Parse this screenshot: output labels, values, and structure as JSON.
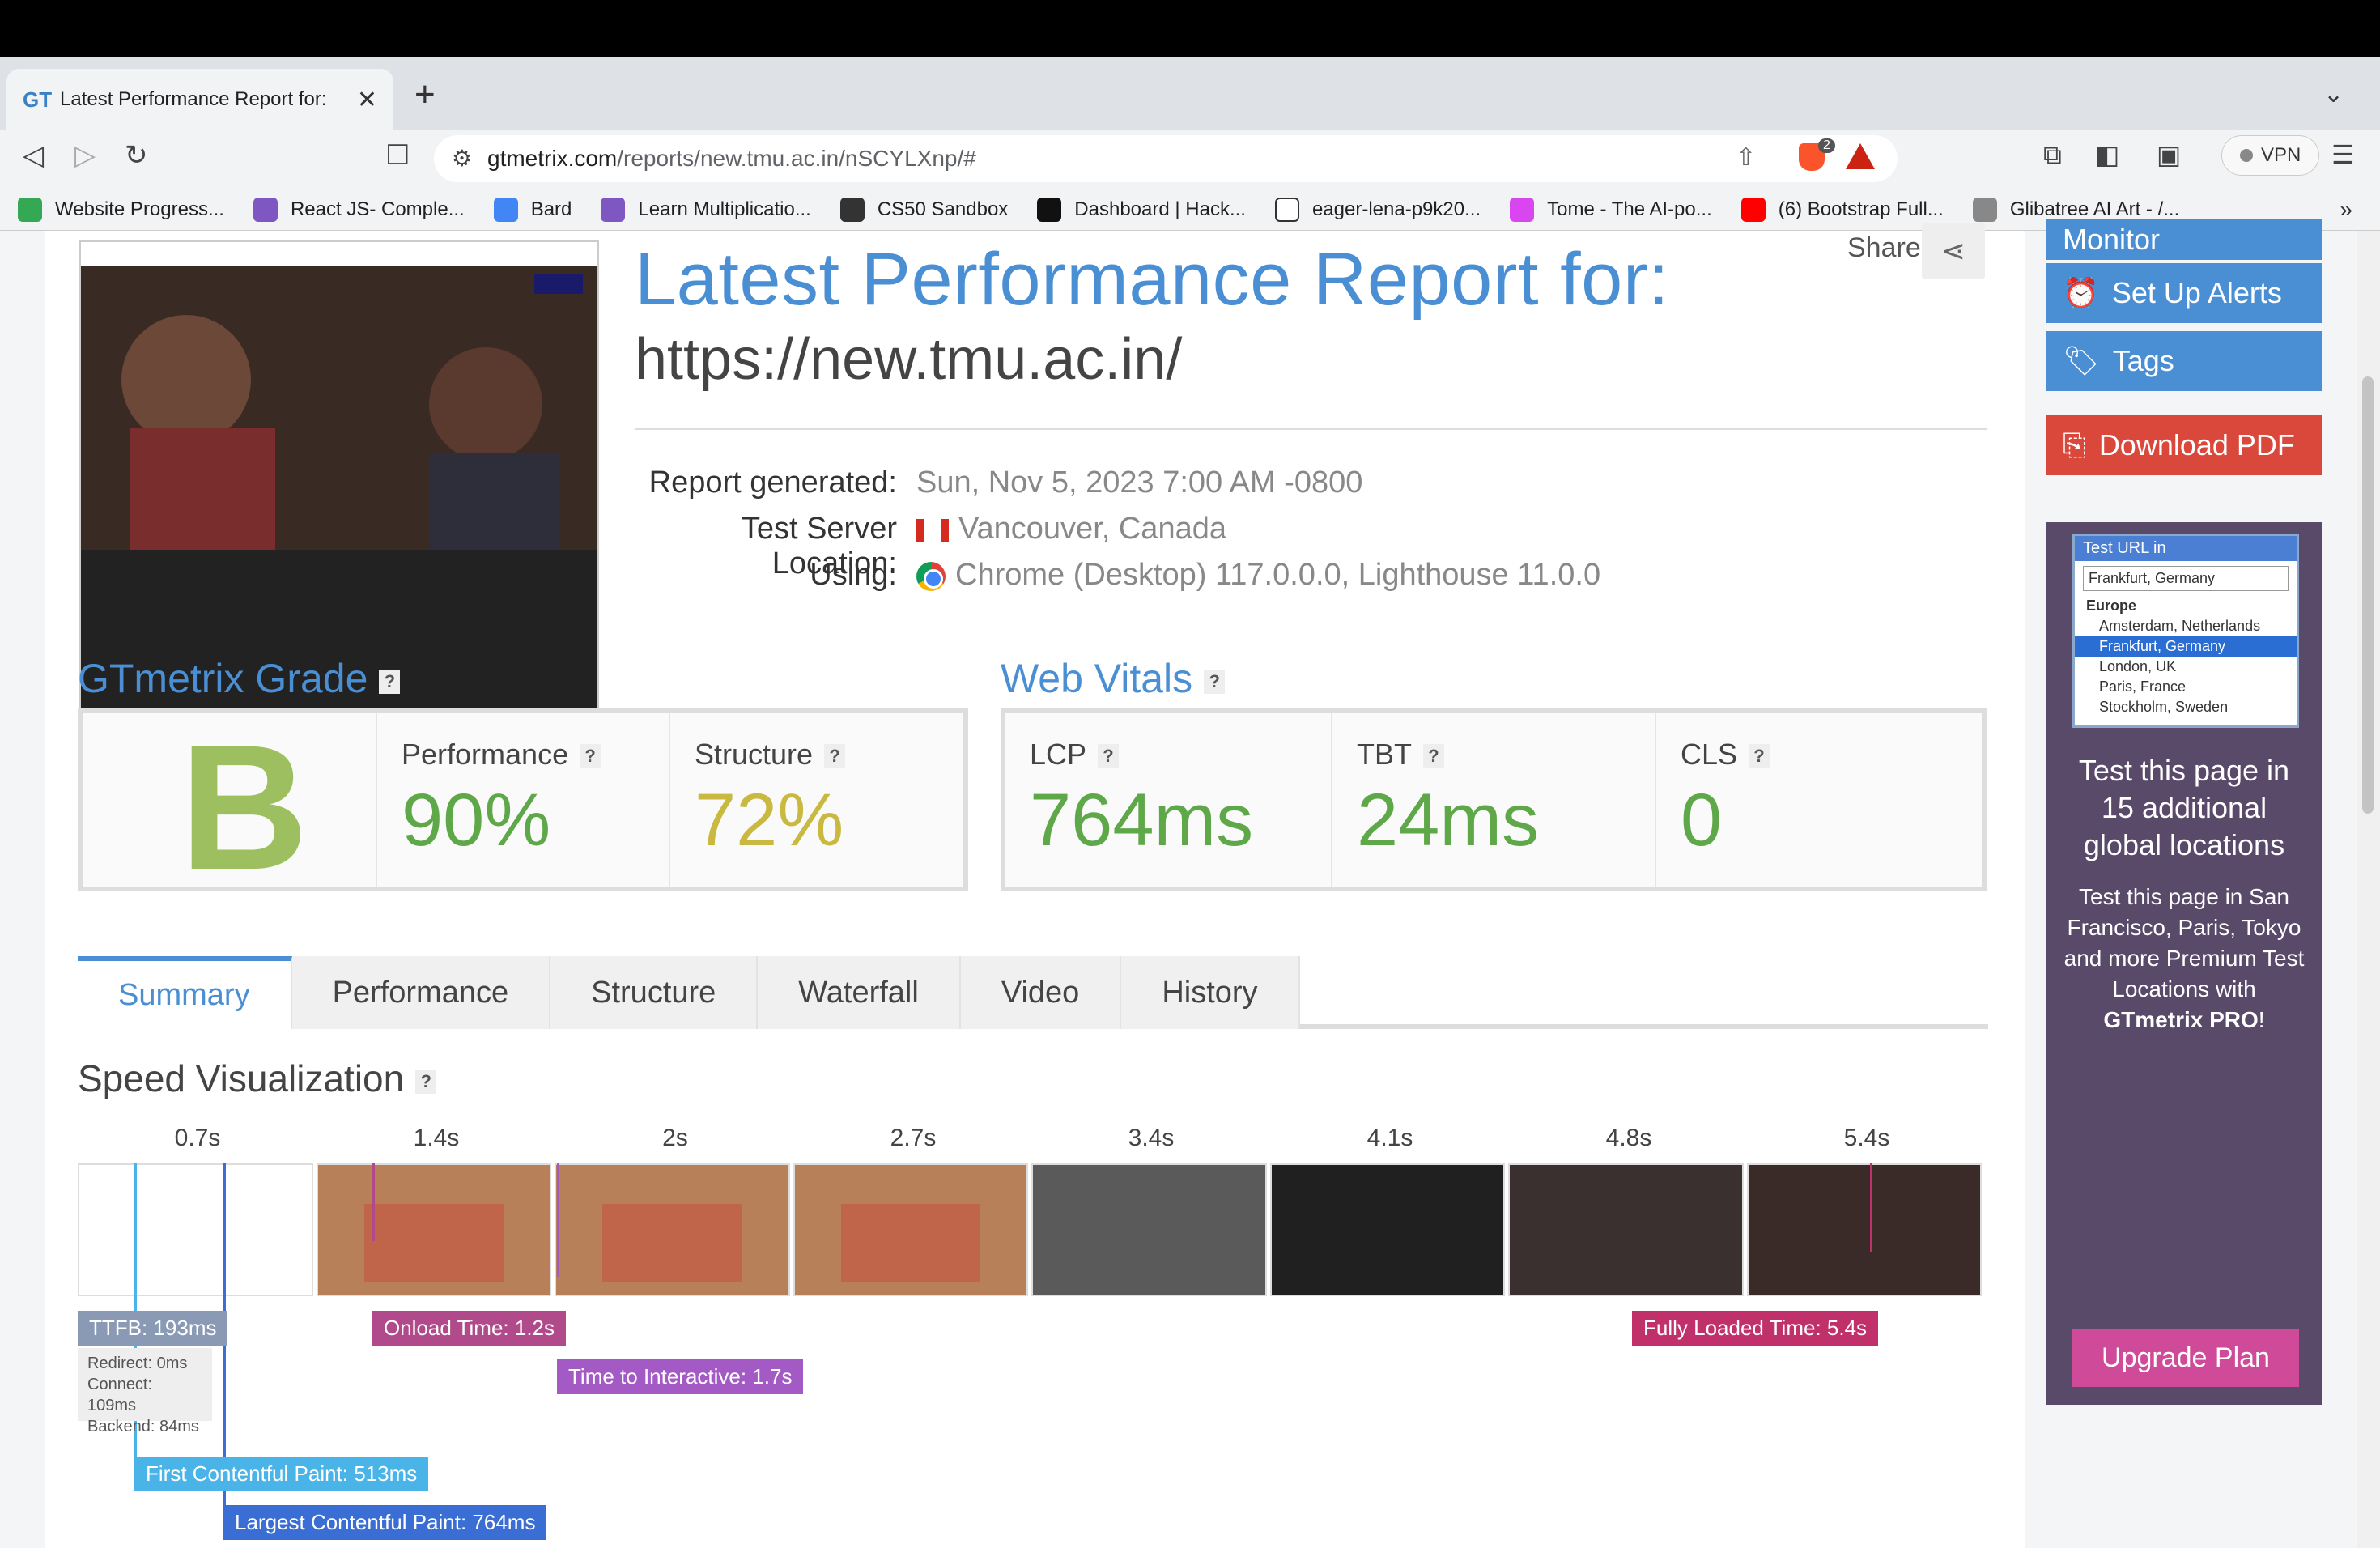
{
  "browser": {
    "tab_title": "Latest Performance Report for:",
    "tab_favicon": "GT",
    "url_host": "gtmetrix.com",
    "url_path": "/reports/new.tmu.ac.in/nSCYLXnp/#",
    "vpn_label": "VPN",
    "brave_badge": "2",
    "bookmarks": [
      {
        "label": "Website Progress...",
        "color": "#34a853"
      },
      {
        "label": "React JS- Comple...",
        "color": "#7e57c2"
      },
      {
        "label": "Bard",
        "color": "#4285f4"
      },
      {
        "label": "Learn Multiplicatio...",
        "color": "#7e57c2"
      },
      {
        "label": "CS50 Sandbox",
        "color": "#333333"
      },
      {
        "label": "Dashboard | Hack...",
        "color": "#111111"
      },
      {
        "label": "eager-lena-p9k20...",
        "color": "#ffffff"
      },
      {
        "label": "Tome - The AI-po...",
        "color": "#d946ef"
      },
      {
        "label": "(6) Bootstrap Full...",
        "color": "#ff0000"
      },
      {
        "label": "Glibatree AI Art - /...",
        "color": "#888888"
      }
    ]
  },
  "report": {
    "title": "Latest Performance Report for:",
    "url": "https://new.tmu.ac.in/",
    "share_label": "Share",
    "generated_label": "Report generated:",
    "generated_value": "Sun, Nov 5, 2023 7:00 AM -0800",
    "location_label": "Test Server Location:",
    "location_value": "Vancouver, Canada",
    "using_label": "Using:",
    "using_value": "Chrome (Desktop) 117.0.0.0, Lighthouse 11.0.0"
  },
  "grade": {
    "title": "GTmetrix Grade",
    "letter": "B",
    "performance_label": "Performance",
    "performance_value": "90%",
    "structure_label": "Structure",
    "structure_value": "72%"
  },
  "vitals": {
    "title": "Web Vitals",
    "lcp_label": "LCP",
    "lcp_value": "764ms",
    "tbt_label": "TBT",
    "tbt_value": "24ms",
    "cls_label": "CLS",
    "cls_value": "0"
  },
  "tabs": [
    "Summary",
    "Performance",
    "Structure",
    "Waterfall",
    "Video",
    "History"
  ],
  "speed": {
    "title": "Speed Visualization",
    "ticks": [
      "0.7s",
      "1.4s",
      "2s",
      "2.7s",
      "3.4s",
      "4.1s",
      "4.8s",
      "5.4s"
    ],
    "ttfb": "TTFB: 193ms",
    "ttfb_redirect": "Redirect: 0ms",
    "ttfb_connect": "Connect: 109ms",
    "ttfb_backend": "Backend: 84ms",
    "onload": "Onload Time: 1.2s",
    "tti": "Time to Interactive: 1.7s",
    "fcp": "First Contentful Paint: 513ms",
    "lcp": "Largest Contentful Paint: 764ms",
    "fully_loaded": "Fully Loaded Time: 5.4s"
  },
  "sidebar": {
    "monitor": "Monitor",
    "alerts": "Set Up Alerts",
    "tags": "Tags",
    "pdf": "Download PDF",
    "promo_shot_header": "Test URL in",
    "promo_shot_selected": "Frankfurt, Germany",
    "promo_shot_group": "Europe",
    "promo_shot_items": [
      "Amsterdam, Netherlands",
      "Frankfurt, Germany",
      "London, UK",
      "Paris, France",
      "Stockholm, Sweden"
    ],
    "promo_big": "Test this page in 15 additional global locations",
    "promo_small_1": "Test this page in San Francisco, Paris, Tokyo and more Premium Test Locations with",
    "promo_small_brand": "GTmetrix PRO",
    "promo_small_end": "!",
    "upgrade": "Upgrade Plan"
  }
}
